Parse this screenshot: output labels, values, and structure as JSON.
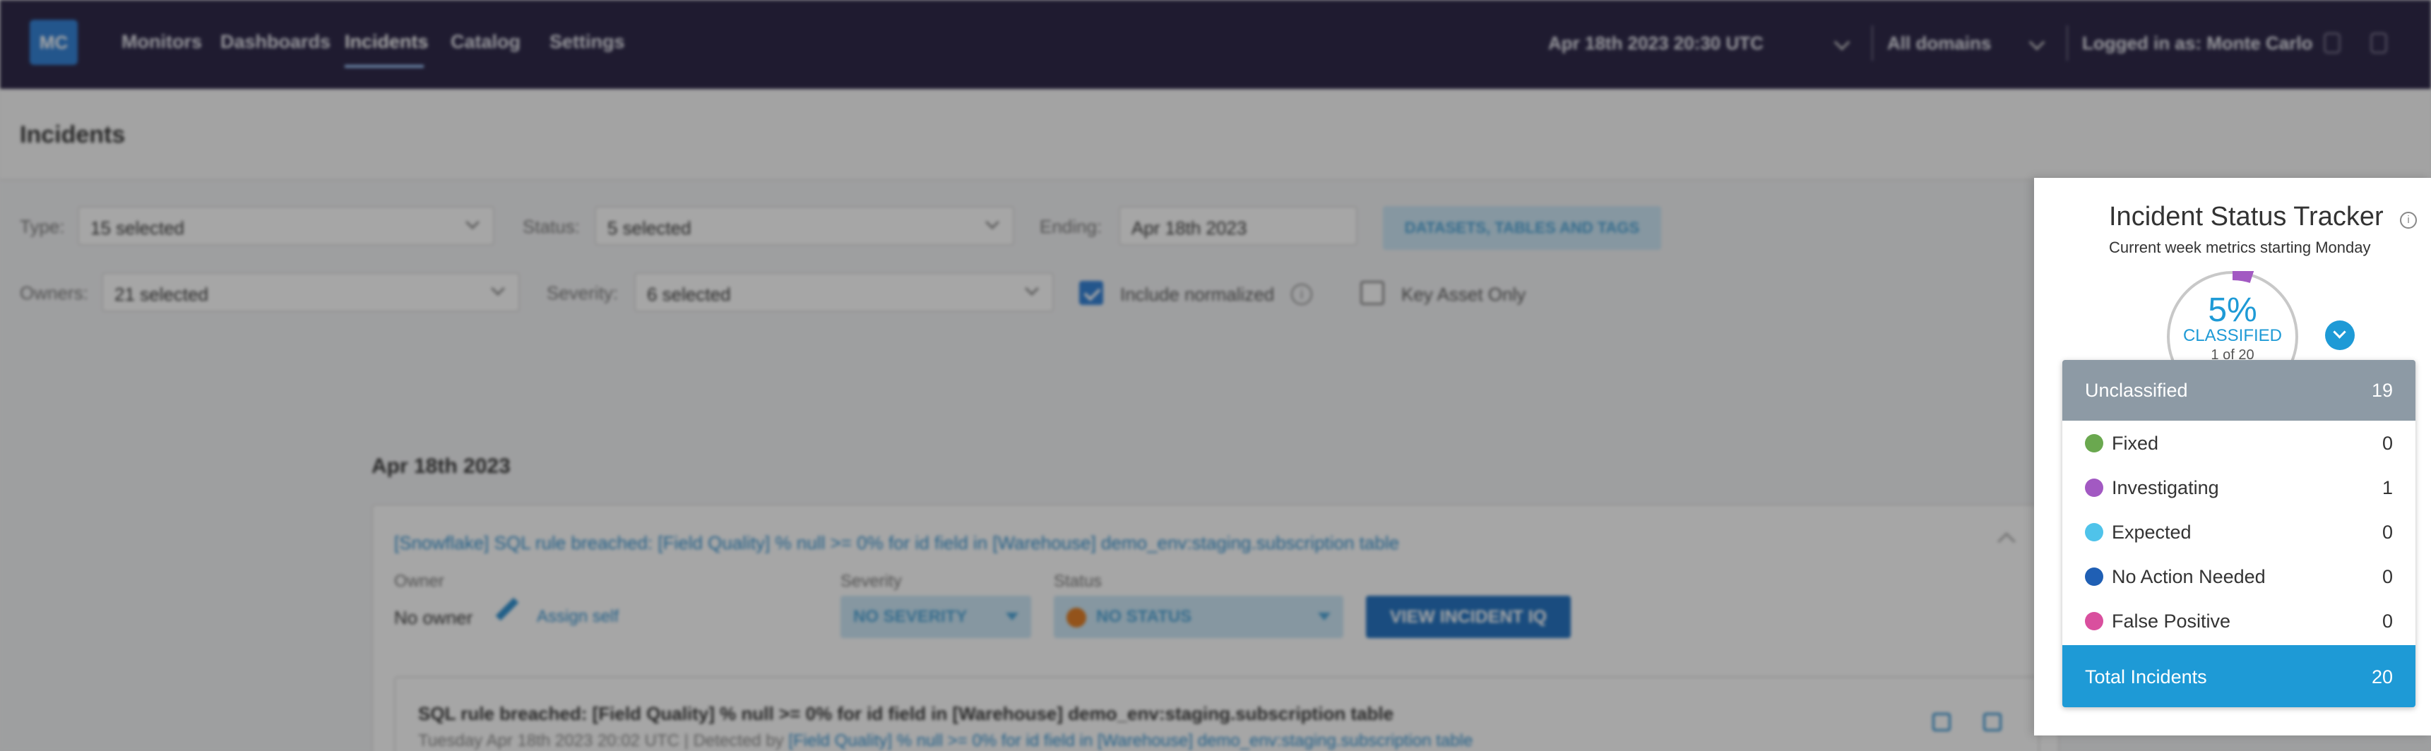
{
  "app": {
    "logo": "MC",
    "nav": [
      "Monitors",
      "Dashboards",
      "Incidents",
      "Catalog",
      "Settings"
    ],
    "active_nav": "Incidents",
    "date_selector": "Apr 18th 2023 20:30 UTC",
    "domain_selector": "All domains",
    "user": "Logged in as: Monte Carlo"
  },
  "page": {
    "title": "Incidents"
  },
  "filters": {
    "type_label": "Type:",
    "type_value": "15 selected",
    "status_label": "Status:",
    "status_value": "5 selected",
    "ending_label": "Ending:",
    "ending_value": "Apr 18th 2023",
    "tags_button": "DATASETS, TABLES AND TAGS",
    "owners_label": "Owners:",
    "owners_value": "21 selected",
    "severity_label": "Severity:",
    "severity_value": "6 selected",
    "include_normalized": "Include normalized",
    "key_asset_only": "Key Asset Only"
  },
  "incidents": {
    "date_heading": "Apr 18th 2023",
    "card": {
      "title": "[Snowflake] SQL rule breached: [Field Quality] % null >= 0% for id field in [Warehouse] demo_env:staging.subscription table",
      "owner_label": "Owner",
      "owner_value": "No owner",
      "assign_self": "Assign self",
      "severity_label": "Severity",
      "severity_value": "NO SEVERITY",
      "status_label": "Status",
      "status_value": "NO STATUS",
      "view_button": "VIEW INCIDENT IQ",
      "event_title": "SQL rule breached: [Field Quality] % null >= 0% for id field in [Warehouse] demo_env:staging.subscription table",
      "event_meta": "Tuesday Apr 18th 2023 20:02 UTC  | Detected by",
      "event_link": "[Field Quality] % null >= 0% for id field in [Warehouse] demo_env:staging.subscription table"
    }
  },
  "tracker": {
    "title": "Incident Status Tracker",
    "subtitle": "Current week metrics starting Monday",
    "percent": "5%",
    "percent_value": 0.05,
    "percent_label": "CLASSIFIED",
    "of_label": "1 of 20",
    "dropdown": {
      "header": {
        "label": "Unclassified",
        "count": "19"
      },
      "items": [
        {
          "label": "Fixed",
          "count": "0",
          "color": "#6aa84f"
        },
        {
          "label": "Investigating",
          "count": "1",
          "color": "#a259c2"
        },
        {
          "label": "Expected",
          "count": "0",
          "color": "#4fc3ea"
        },
        {
          "label": "No Action Needed",
          "count": "0",
          "color": "#1f5fb4"
        },
        {
          "label": "False Positive",
          "count": "0",
          "color": "#d94f9e"
        }
      ],
      "total": {
        "label": "Total Incidents",
        "count": "20"
      }
    }
  }
}
